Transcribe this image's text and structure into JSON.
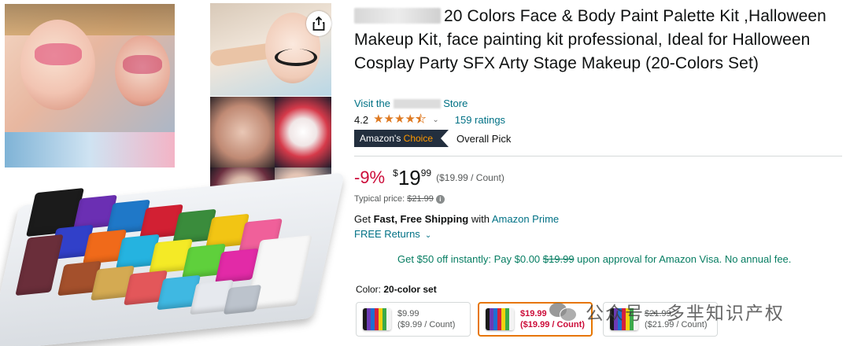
{
  "product": {
    "title": "20 Colors Face & Body Paint Palette Kit ,Halloween Makeup Kit, face painting kit professional, Ideal for Halloween Cosplay Party SFX Arty Stage Makeup (20-Colors Set)",
    "store_prefix": "Visit the",
    "store_suffix": "Store",
    "rating": "4.2",
    "rating_value": 4.2,
    "ratings_count": "159 ratings",
    "badge_prefix": "Amazon's",
    "badge_accent": "Choice",
    "badge_text": "Overall Pick"
  },
  "price": {
    "discount": "-9%",
    "currency": "$",
    "whole": "19",
    "fraction": "99",
    "unit_price": "($19.99 / Count)",
    "typical_label": "Typical price:",
    "typical_value": "$21.99"
  },
  "shipping": {
    "prefix": "Get",
    "bold": "Fast, Free Shipping",
    "mid": "with",
    "link": "Amazon Prime",
    "returns": "FREE Returns"
  },
  "offer": {
    "pre": "Get $50 off instantly: Pay $0.00",
    "strike": "$19.99",
    "post": "upon approval for Amazon Visa. No annual fee."
  },
  "options": {
    "label": "Color:",
    "selected_value": "20-color set",
    "swatches": [
      {
        "price": "$9.99",
        "unit": "($9.99 / Count)"
      },
      {
        "price": "$19.99",
        "unit": "($19.99 / Count)"
      },
      {
        "price": "$21.99",
        "unit": "($21.99 / Count)"
      }
    ]
  },
  "watermark": {
    "text": "公众号 · 多芈知识产权"
  },
  "icons": {
    "share": "share-icon",
    "star": "star-icon",
    "chevron": "chevron-down-icon",
    "info": "info-icon"
  },
  "colors": {
    "link": "#007185",
    "deal_red": "#cc0c39",
    "star": "#de7921",
    "badge_bg": "#232f3e",
    "badge_accent": "#ff9900",
    "offer_green": "#067d62",
    "selected_border": "#e77600"
  }
}
